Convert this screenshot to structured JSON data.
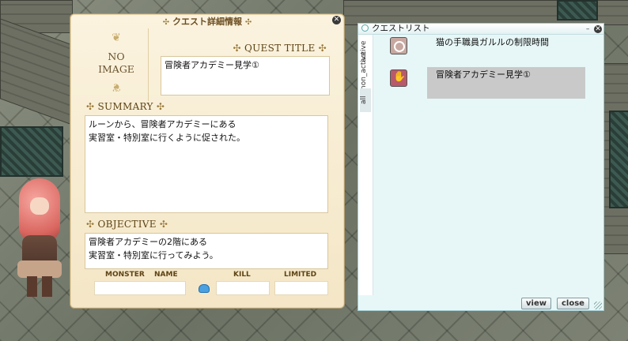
{
  "quest_detail": {
    "title": "クエスト詳細情報",
    "no_image": [
      "NO",
      "IMAGE"
    ],
    "quest_title_label": "QUEST TITLE",
    "quest_title": "冒険者アカデミー見学①",
    "summary_label": "SUMMARY",
    "summary_lines": [
      "ルーンから、冒険者アカデミーにある",
      "実習室・特別室に行くように促された。"
    ],
    "objective_label": "OBJECTIVE",
    "objective_lines": [
      "冒険者アカデミーの2階にある",
      "実習室・特別室に行ってみよう。"
    ],
    "columns": {
      "monster": "MONSTER",
      "name": "NAME",
      "kill": "KILL",
      "limited": "LIMITED"
    },
    "ornament": "✣"
  },
  "quest_list": {
    "title": "クエストリスト",
    "tabs": [
      "active",
      "non_active",
      "all"
    ],
    "items": [
      {
        "label": "猫の手職員ガルルの制限時間",
        "icon": "clock-icon"
      },
      {
        "label": "冒険者アカデミー見学①",
        "icon": "hand-icon"
      }
    ],
    "view_label": "view",
    "close_label": "close"
  },
  "colors": {
    "parchment": "#f4e6c6",
    "list_bg": "#e7f7f7",
    "selection": "#c9c9c9",
    "heading": "#5e4416"
  }
}
